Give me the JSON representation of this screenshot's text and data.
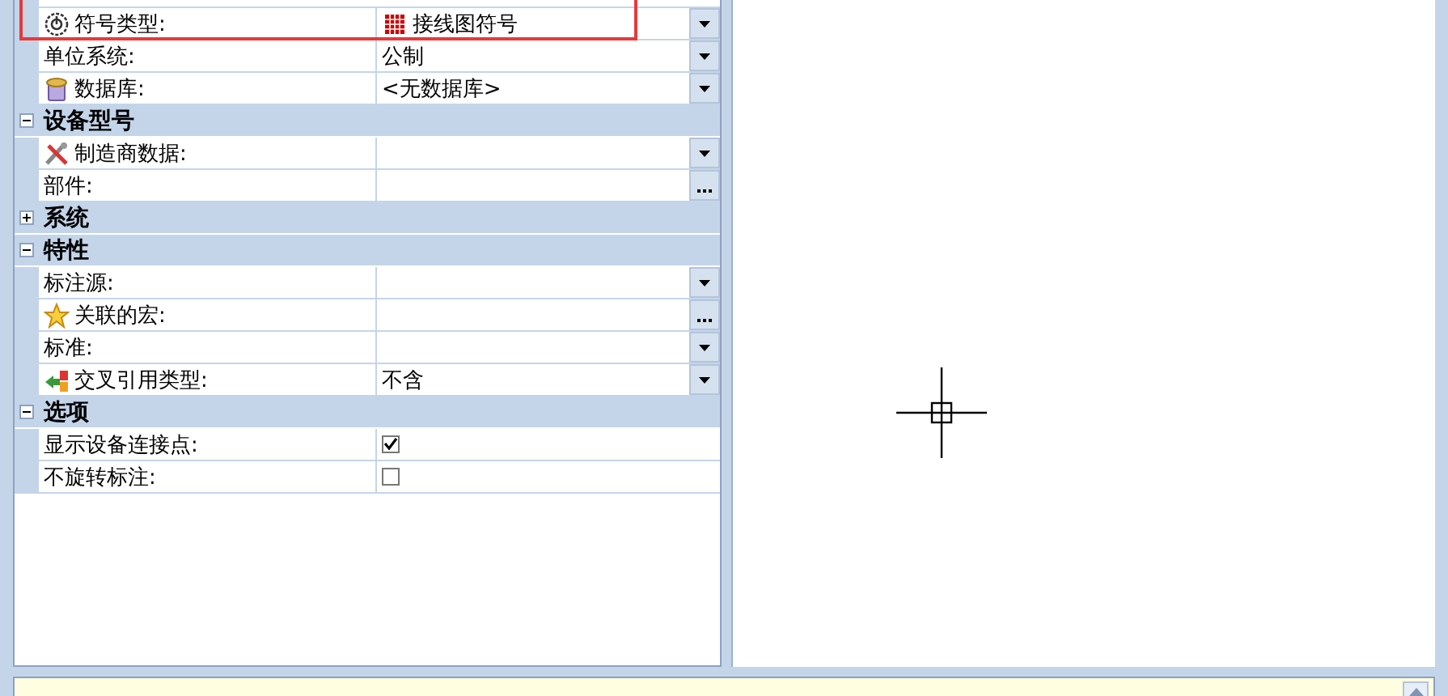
{
  "property_grid": {
    "groups": [
      {
        "rows": [
          {
            "label": "符号类型:",
            "value": "接线图符号",
            "kind": "dropdown",
            "highlighted": true
          },
          {
            "label": "单位系统:",
            "value": "公制",
            "kind": "dropdown"
          },
          {
            "label": "数据库:",
            "value": "<无数据库>",
            "kind": "dropdown"
          }
        ]
      },
      {
        "title": "设备型号",
        "expanded": true,
        "rows": [
          {
            "label": "制造商数据:",
            "kind": "dropdown"
          },
          {
            "label": "部件:",
            "kind": "ellipsis"
          }
        ]
      },
      {
        "title": "系统",
        "expanded": false
      },
      {
        "title": "特性",
        "expanded": true,
        "rows": [
          {
            "label": "标注源:",
            "kind": "dropdown"
          },
          {
            "label": "关联的宏:",
            "kind": "ellipsis"
          },
          {
            "label": "标准:",
            "kind": "dropdown"
          },
          {
            "label": "交叉引用类型:",
            "value": "不含",
            "kind": "dropdown"
          }
        ]
      },
      {
        "title": "选项",
        "expanded": true,
        "rows": [
          {
            "label": "显示设备连接点:",
            "kind": "checkbox",
            "checked": true
          },
          {
            "label": "不旋转标注:",
            "kind": "checkbox",
            "checked": false
          }
        ]
      }
    ]
  }
}
